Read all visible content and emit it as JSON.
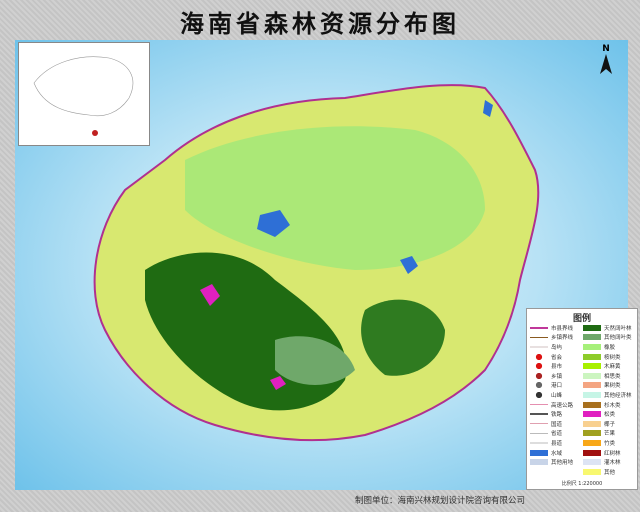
{
  "title": "海南省森林资源分布图",
  "north": "N",
  "credit": "制图单位：海南兴林规划设计院咨询有限公司",
  "legend": {
    "title": "图例",
    "left": [
      {
        "label": "市县界线",
        "color": "#c0389a",
        "icon": "line"
      },
      {
        "label": "乡镇界线",
        "color": "#8a5a20",
        "icon": "line"
      },
      {
        "label": "岛屿",
        "color": "#e8e0e0",
        "icon": "line"
      },
      {
        "label": "省会",
        "color": "#d11",
        "icon": "dot"
      },
      {
        "label": "县市",
        "color": "#d11",
        "icon": "dot"
      },
      {
        "label": "乡镇",
        "color": "#a22",
        "icon": "dot"
      },
      {
        "label": "港口",
        "color": "#666",
        "icon": "dot"
      },
      {
        "label": "山峰",
        "color": "#333",
        "icon": "peak"
      },
      {
        "label": "高速公路",
        "color": "#e58fb0",
        "icon": "line"
      },
      {
        "label": "铁路",
        "color": "#555",
        "icon": "line"
      },
      {
        "label": "国道",
        "color": "#e0a0b0",
        "icon": "line"
      },
      {
        "label": "省道",
        "color": "#bbb",
        "icon": "line"
      },
      {
        "label": "县道",
        "color": "#ddd",
        "icon": "line"
      },
      {
        "label": "水域",
        "color": "#2e6fd6",
        "icon": "fill"
      },
      {
        "label": "其他用地",
        "color": "#c8d4e8",
        "icon": "fill"
      }
    ],
    "right": [
      {
        "label": "天然阔叶林",
        "color": "#1f6b12"
      },
      {
        "label": "其他阔叶类",
        "color": "#6fa86a"
      },
      {
        "label": "橡胶",
        "color": "#a6f07a"
      },
      {
        "label": "桉树类",
        "color": "#8dcc2a"
      },
      {
        "label": "木麻黄",
        "color": "#a8f000"
      },
      {
        "label": "相思类",
        "color": "#ccf5c0"
      },
      {
        "label": "果树类",
        "color": "#f4a582"
      },
      {
        "label": "其他经济林",
        "color": "#c6f5e6"
      },
      {
        "label": "杉木类",
        "color": "#a8701e"
      },
      {
        "label": "松类",
        "color": "#e020c0"
      },
      {
        "label": "椰子",
        "color": "#f8d090"
      },
      {
        "label": "芒果",
        "color": "#a0a020"
      },
      {
        "label": "竹类",
        "color": "#f8a818"
      },
      {
        "label": "红树林",
        "color": "#a01010"
      },
      {
        "label": "灌木林",
        "color": "#dde4f4"
      },
      {
        "label": "其他",
        "color": "#f8f870"
      }
    ],
    "scale": "比例尺  1:220000"
  }
}
